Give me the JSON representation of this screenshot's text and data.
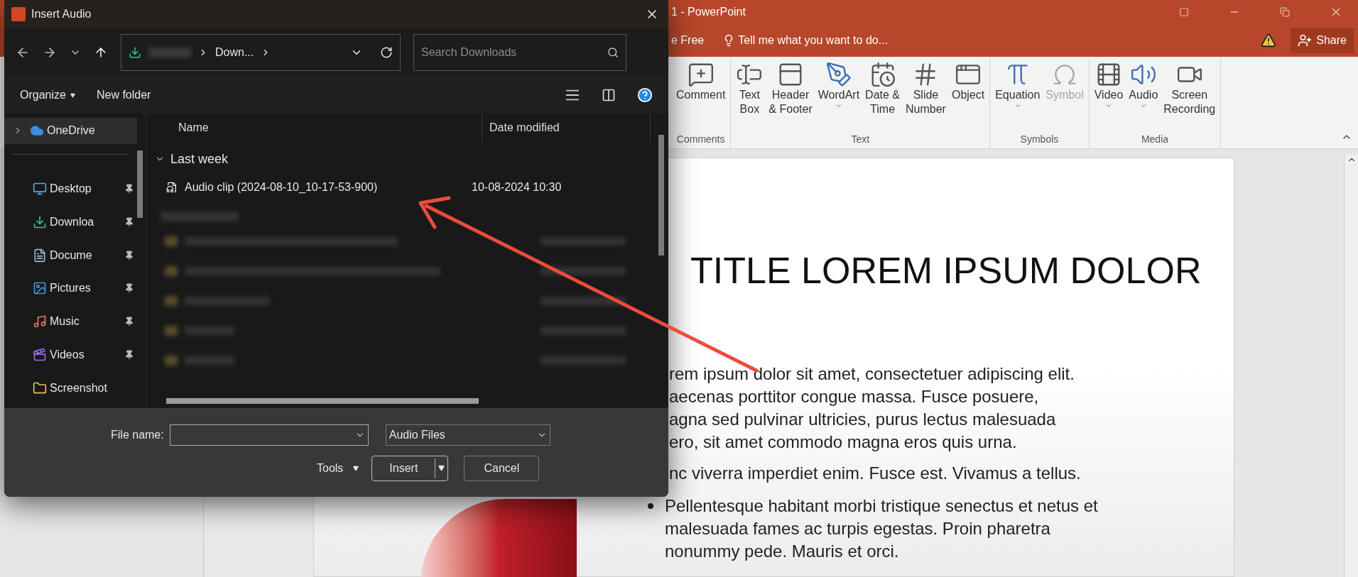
{
  "powerpoint": {
    "title": "1 - PowerPoint",
    "partial_tab": "e Free",
    "tell_me": "Tell me what you want to do...",
    "share": "Share",
    "ribbon_groups": [
      {
        "label": "Comments",
        "items": [
          {
            "kind": "comment",
            "lines": [
              "Comment"
            ],
            "dropdown": false,
            "disabled": false
          }
        ]
      },
      {
        "label": "Text",
        "items": [
          {
            "kind": "textbox",
            "lines": [
              "Text",
              "Box"
            ],
            "dropdown": false,
            "disabled": false
          },
          {
            "kind": "header",
            "lines": [
              "Header",
              "& Footer"
            ],
            "dropdown": false,
            "disabled": false
          },
          {
            "kind": "wordart",
            "lines": [
              "WordArt"
            ],
            "dropdown": true,
            "disabled": false
          },
          {
            "kind": "datetime",
            "lines": [
              "Date &",
              "Time"
            ],
            "dropdown": false,
            "disabled": false
          },
          {
            "kind": "slidenumber",
            "lines": [
              "Slide",
              "Number"
            ],
            "dropdown": false,
            "disabled": false
          },
          {
            "kind": "object",
            "lines": [
              "Object"
            ],
            "dropdown": false,
            "disabled": false
          }
        ]
      },
      {
        "label": "Symbols",
        "items": [
          {
            "kind": "equation",
            "lines": [
              "Equation"
            ],
            "dropdown": true,
            "disabled": false
          },
          {
            "kind": "symbol",
            "lines": [
              "Symbol"
            ],
            "dropdown": false,
            "disabled": true
          }
        ]
      },
      {
        "label": "Media",
        "items": [
          {
            "kind": "video",
            "lines": [
              "Video"
            ],
            "dropdown": true,
            "disabled": false
          },
          {
            "kind": "audio",
            "lines": [
              "Audio"
            ],
            "dropdown": true,
            "disabled": false
          },
          {
            "kind": "screenrec",
            "lines": [
              "Screen",
              "Recording"
            ],
            "dropdown": false,
            "disabled": false
          }
        ]
      }
    ]
  },
  "slide": {
    "title": "TITLE LOREM IPSUM DOLOR",
    "covered_paragraphs": [
      [
        "rem ipsum dolor sit amet, consectetuer adipiscing elit.",
        "aecenas porttitor congue massa. Fusce posuere,",
        "agna sed pulvinar ultricies, purus lectus malesuada",
        "ero, sit amet commodo magna eros quis urna."
      ],
      [
        "nc viverra imperdiet enim. Fusce est. Vivamus a tellus."
      ]
    ],
    "bullets": [
      "Pellentesque habitant morbi tristique senectus et netus et malesuada fames ac turpis egestas. Proin pharetra nonummy pede. Mauris et orci."
    ]
  },
  "dialog": {
    "title": "Insert Audio",
    "address": "Down...",
    "search_placeholder": "Search Downloads",
    "organize": "Organize",
    "new_folder": "New folder",
    "nav": [
      {
        "label": "OneDrive",
        "kind": "cloud",
        "selected": true,
        "pinned": false
      },
      {
        "label": "Desktop",
        "kind": "desktop",
        "selected": false,
        "pinned": true
      },
      {
        "label": "Downloa",
        "kind": "download",
        "selected": false,
        "pinned": true
      },
      {
        "label": "Docume",
        "kind": "document",
        "selected": false,
        "pinned": true
      },
      {
        "label": "Pictures",
        "kind": "picture",
        "selected": false,
        "pinned": true
      },
      {
        "label": "Music",
        "kind": "music",
        "selected": false,
        "pinned": true
      },
      {
        "label": "Videos",
        "kind": "video",
        "selected": false,
        "pinned": true
      },
      {
        "label": "Screenshot",
        "kind": "folder",
        "selected": false,
        "pinned": false
      }
    ],
    "columns": [
      "Name",
      "Date modified"
    ],
    "groups": [
      {
        "label": "Last week",
        "expanded": true,
        "files": [
          {
            "name": "Audio clip (2024-08-10_10-17-53-900)",
            "date": "10-08-2024 10:30",
            "selected": false
          }
        ]
      }
    ],
    "file_name_label": "File name:",
    "file_type": "Audio Files",
    "tools": "Tools",
    "insert": "Insert",
    "cancel": "Cancel"
  }
}
